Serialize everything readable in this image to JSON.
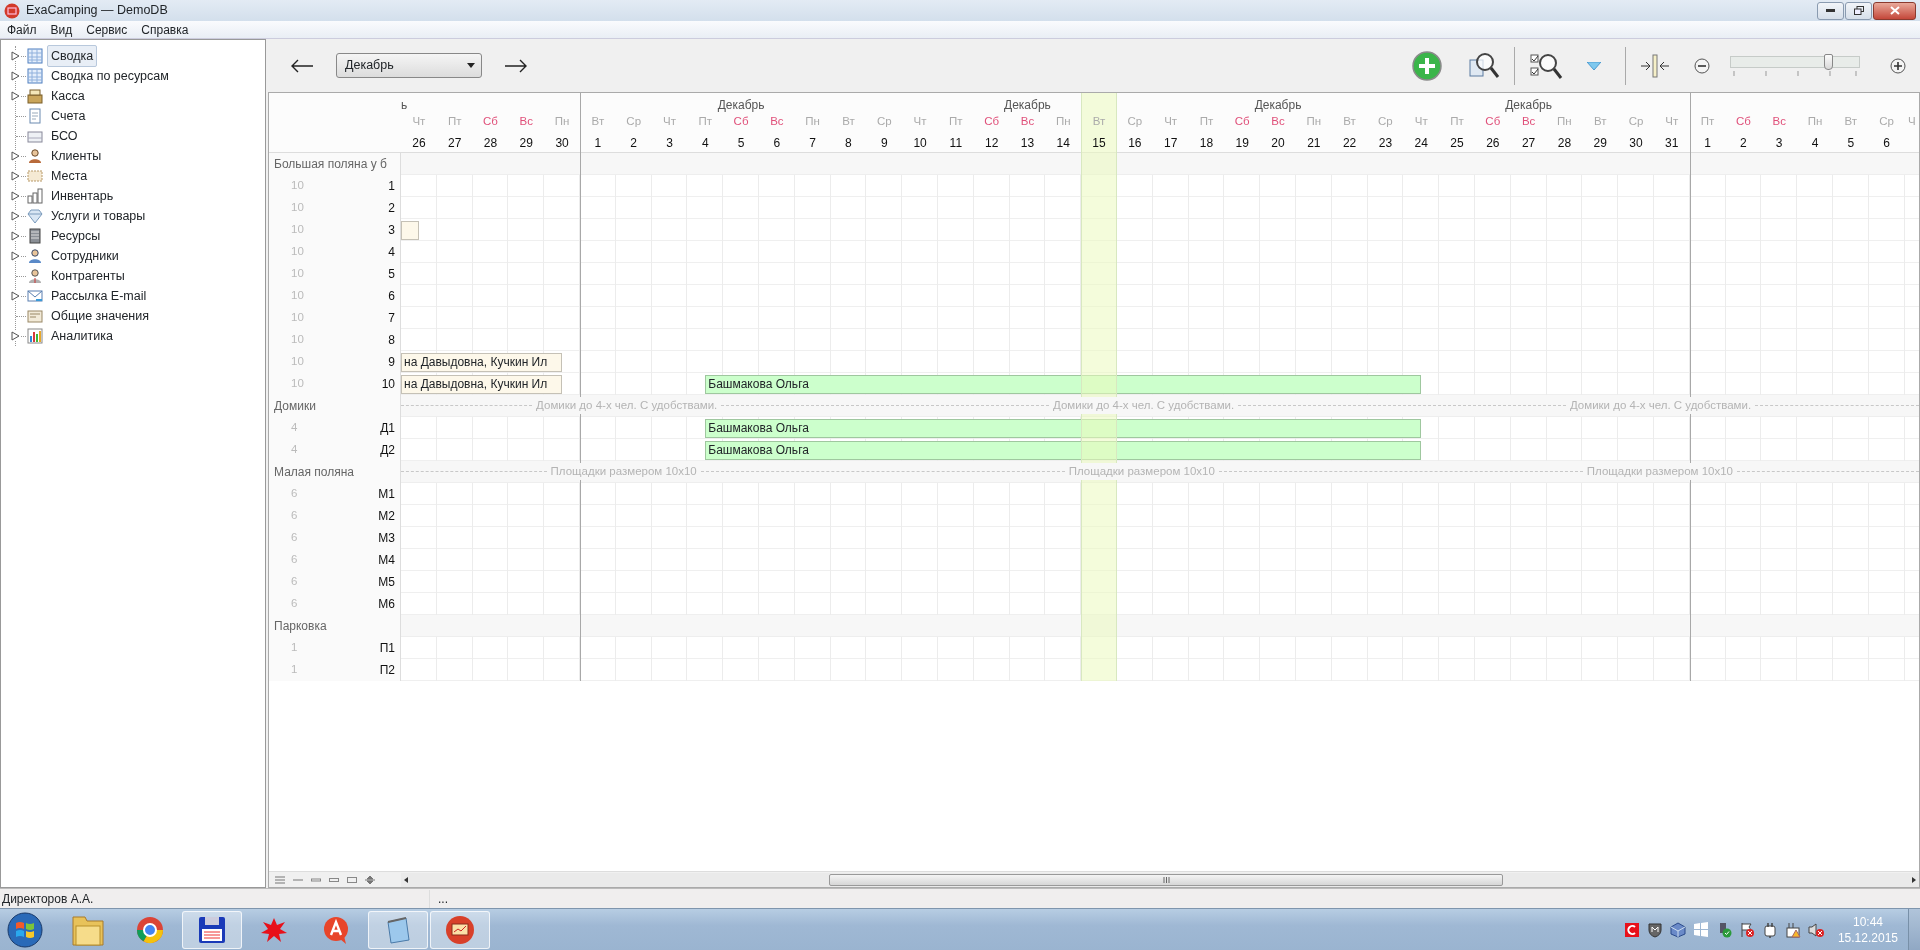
{
  "window": {
    "title": "ExaCamping — DemoDB"
  },
  "menu": [
    "Файл",
    "Вид",
    "Сервис",
    "Справка"
  ],
  "sidebar": {
    "items": [
      {
        "label": "Сводка",
        "expandable": true,
        "selected": true
      },
      {
        "label": "Сводка по ресурсам",
        "expandable": true,
        "selected": false
      },
      {
        "label": "Касса",
        "expandable": true,
        "selected": false
      },
      {
        "label": "Счета",
        "expandable": false,
        "selected": false
      },
      {
        "label": "БСО",
        "expandable": false,
        "selected": false
      },
      {
        "label": "Клиенты",
        "expandable": true,
        "selected": false
      },
      {
        "label": "Места",
        "expandable": true,
        "selected": false
      },
      {
        "label": "Инвентарь",
        "expandable": true,
        "selected": false
      },
      {
        "label": "Услуги и товары",
        "expandable": true,
        "selected": false
      },
      {
        "label": "Ресурсы",
        "expandable": true,
        "selected": false
      },
      {
        "label": "Сотрудники",
        "expandable": true,
        "selected": false
      },
      {
        "label": "Контрагенты",
        "expandable": false,
        "selected": false
      },
      {
        "label": "Рассылка E-mail",
        "expandable": true,
        "selected": false
      },
      {
        "label": "Общие значения",
        "expandable": false,
        "selected": false
      },
      {
        "label": "Аналитика",
        "expandable": true,
        "selected": false
      }
    ]
  },
  "toolbar": {
    "month": "Декабрь",
    "zoom": {
      "level": 0.76
    }
  },
  "calendar": {
    "days": [
      {
        "month_label": "ь",
        "dow": "Чт",
        "date": "26",
        "weekend": false,
        "month_start": false,
        "today": false
      },
      {
        "dow": "Пт",
        "date": "27",
        "weekend": false,
        "month_start": false,
        "today": false
      },
      {
        "dow": "Сб",
        "date": "28",
        "weekend": true,
        "month_start": false,
        "today": false
      },
      {
        "dow": "Вс",
        "date": "29",
        "weekend": true,
        "month_start": false,
        "today": false
      },
      {
        "dow": "Пн",
        "date": "30",
        "weekend": false,
        "month_start": false,
        "today": false
      },
      {
        "dow": "Вт",
        "date": "1",
        "weekend": false,
        "month_start": true,
        "today": false
      },
      {
        "dow": "Ср",
        "date": "2",
        "weekend": false,
        "month_start": false,
        "today": false
      },
      {
        "dow": "Чт",
        "date": "3",
        "weekend": false,
        "month_start": false,
        "today": false
      },
      {
        "dow": "Пт",
        "date": "4",
        "weekend": false,
        "month_start": false,
        "today": false
      },
      {
        "month_label": "Декабрь",
        "dow": "Сб",
        "date": "5",
        "weekend": true,
        "month_start": false,
        "today": false
      },
      {
        "dow": "Вс",
        "date": "6",
        "weekend": true,
        "month_start": false,
        "today": false
      },
      {
        "dow": "Пн",
        "date": "7",
        "weekend": false,
        "month_start": false,
        "today": false
      },
      {
        "dow": "Вт",
        "date": "8",
        "weekend": false,
        "month_start": false,
        "today": false
      },
      {
        "dow": "Ср",
        "date": "9",
        "weekend": false,
        "month_start": false,
        "today": false
      },
      {
        "dow": "Чт",
        "date": "10",
        "weekend": false,
        "month_start": false,
        "today": false
      },
      {
        "dow": "Пт",
        "date": "11",
        "weekend": false,
        "month_start": false,
        "today": false
      },
      {
        "dow": "Сб",
        "date": "12",
        "weekend": true,
        "month_start": false,
        "today": false
      },
      {
        "month_label": "Декабрь",
        "dow": "Вс",
        "date": "13",
        "weekend": true,
        "month_start": false,
        "today": false
      },
      {
        "dow": "Пн",
        "date": "14",
        "weekend": false,
        "month_start": false,
        "today": false
      },
      {
        "dow": "Вт",
        "date": "15",
        "weekend": false,
        "month_start": false,
        "today": true
      },
      {
        "dow": "Ср",
        "date": "16",
        "weekend": false,
        "month_start": false,
        "today": false
      },
      {
        "dow": "Чт",
        "date": "17",
        "weekend": false,
        "month_start": false,
        "today": false
      },
      {
        "dow": "Пт",
        "date": "18",
        "weekend": false,
        "month_start": false,
        "today": false
      },
      {
        "dow": "Сб",
        "date": "19",
        "weekend": true,
        "month_start": false,
        "today": false
      },
      {
        "month_label": "Декабрь",
        "dow": "Вс",
        "date": "20",
        "weekend": true,
        "month_start": false,
        "today": false
      },
      {
        "dow": "Пн",
        "date": "21",
        "weekend": false,
        "month_start": false,
        "today": false
      },
      {
        "dow": "Вт",
        "date": "22",
        "weekend": false,
        "month_start": false,
        "today": false
      },
      {
        "dow": "Ср",
        "date": "23",
        "weekend": false,
        "month_start": false,
        "today": false
      },
      {
        "dow": "Чт",
        "date": "24",
        "weekend": false,
        "month_start": false,
        "today": false
      },
      {
        "dow": "Пт",
        "date": "25",
        "weekend": false,
        "month_start": false,
        "today": false
      },
      {
        "dow": "Сб",
        "date": "26",
        "weekend": true,
        "month_start": false,
        "today": false
      },
      {
        "month_label": "Декабрь",
        "dow": "Вс",
        "date": "27",
        "weekend": true,
        "month_start": false,
        "today": false
      },
      {
        "dow": "Пн",
        "date": "28",
        "weekend": false,
        "month_start": false,
        "today": false
      },
      {
        "dow": "Вт",
        "date": "29",
        "weekend": false,
        "month_start": false,
        "today": false
      },
      {
        "dow": "Ср",
        "date": "30",
        "weekend": false,
        "month_start": false,
        "today": false
      },
      {
        "dow": "Чт",
        "date": "31",
        "weekend": false,
        "month_start": false,
        "today": false
      },
      {
        "dow": "Пт",
        "date": "1",
        "weekend": false,
        "month_start": true,
        "today": false
      },
      {
        "dow": "Сб",
        "date": "2",
        "weekend": true,
        "month_start": false,
        "today": false
      },
      {
        "dow": "Вс",
        "date": "3",
        "weekend": true,
        "month_start": false,
        "today": false
      },
      {
        "dow": "Пн",
        "date": "4",
        "weekend": false,
        "month_start": false,
        "today": false
      },
      {
        "dow": "Вт",
        "date": "5",
        "weekend": false,
        "month_start": false,
        "today": false
      },
      {
        "dow": "Ср",
        "date": "6",
        "weekend": false,
        "month_start": false,
        "today": false
      },
      {
        "dow": "Ч",
        "weekend": false,
        "month_start": false,
        "today": false
      }
    ],
    "groups": [
      {
        "label": "Большая поляна у б",
        "rows": [
          {
            "capacity": "10",
            "label": "1"
          },
          {
            "capacity": "10",
            "label": "2"
          },
          {
            "capacity": "10",
            "label": "3",
            "cells": [
              {
                "kind": "end",
                "booking": {
                  "color": "#fdf8ea"
                }
              }
            ]
          },
          {
            "capacity": "10",
            "label": "4"
          },
          {
            "capacity": "10",
            "label": "5"
          },
          {
            "capacity": "10",
            "label": "6"
          },
          {
            "capacity": "10",
            "label": "7"
          },
          {
            "capacity": "10",
            "label": "8"
          },
          {
            "capacity": "10",
            "label": "9",
            "cells": [
              {
                "kind": "middle",
                "booking": {
                  "text": "на Давыдовна, Кучкин Ил",
                  "color": "#fdf8ea"
                }
              },
              {
                "kind": "middle"
              },
              {
                "kind": "middle"
              },
              {
                "kind": "middle"
              },
              {
                "kind": "end"
              }
            ]
          },
          {
            "capacity": "10",
            "label": "10",
            "cells": [
              {
                "kind": "middle",
                "booking": {
                  "text": "на Давыдовна, Кучкин Ил",
                  "color": "#fdf8ea"
                }
              },
              {
                "kind": "middle"
              },
              {
                "kind": "middle"
              },
              {
                "kind": "middle"
              },
              {
                "kind": "end"
              },
              {
                "kind": "free"
              },
              {
                "kind": "free"
              },
              {
                "kind": "free"
              },
              {
                "kind": "start",
                "booking": {
                  "text": "Башмакова Ольга",
                  "color": "#ccffcc"
                }
              },
              {
                "kind": "middle"
              },
              {
                "kind": "middle"
              },
              {
                "kind": "middle"
              },
              {
                "kind": "middle"
              },
              {
                "kind": "middle"
              },
              {
                "kind": "middle"
              },
              {
                "kind": "middle"
              },
              {
                "kind": "middle"
              },
              {
                "kind": "middle"
              },
              {
                "kind": "middle"
              },
              {
                "kind": "middle"
              },
              {
                "kind": "middle"
              },
              {
                "kind": "middle"
              },
              {
                "kind": "middle"
              },
              {
                "kind": "middle"
              },
              {
                "kind": "middle"
              },
              {
                "kind": "middle"
              },
              {
                "kind": "middle"
              },
              {
                "kind": "middle"
              },
              {
                "kind": "end"
              }
            ]
          }
        ]
      },
      {
        "label": "Домики",
        "notes": [
          "Домики до 4-х чел. С удобствами.",
          "Домики до 4-х чел. С удобствами.",
          "Домики до 4-х чел. С удобствами."
        ],
        "rows": [
          {
            "capacity": "4",
            "label": "Д1",
            "cells": [
              {
                "kind": "free"
              },
              {
                "kind": "free"
              },
              {
                "kind": "free"
              },
              {
                "kind": "free"
              },
              {
                "kind": "free"
              },
              {
                "kind": "free"
              },
              {
                "kind": "free"
              },
              {
                "kind": "free"
              },
              {
                "kind": "start",
                "booking": {
                  "text": "Башмакова Ольга",
                  "color": "#ccffcc"
                }
              },
              {
                "kind": "middle"
              },
              {
                "kind": "middle"
              },
              {
                "kind": "middle"
              },
              {
                "kind": "middle"
              },
              {
                "kind": "middle"
              },
              {
                "kind": "middle"
              },
              {
                "kind": "middle"
              },
              {
                "kind": "middle"
              },
              {
                "kind": "middle"
              },
              {
                "kind": "middle"
              },
              {
                "kind": "middle"
              },
              {
                "kind": "middle"
              },
              {
                "kind": "middle"
              },
              {
                "kind": "middle"
              },
              {
                "kind": "middle"
              },
              {
                "kind": "middle"
              },
              {
                "kind": "middle"
              },
              {
                "kind": "middle"
              },
              {
                "kind": "middle"
              },
              {
                "kind": "end"
              }
            ]
          },
          {
            "capacity": "4",
            "label": "Д2",
            "cells": [
              {
                "kind": "free"
              },
              {
                "kind": "free"
              },
              {
                "kind": "free"
              },
              {
                "kind": "free"
              },
              {
                "kind": "free"
              },
              {
                "kind": "free"
              },
              {
                "kind": "free"
              },
              {
                "kind": "free"
              },
              {
                "kind": "start",
                "booking": {
                  "text": "Башмакова Ольга",
                  "color": "#ccffcc"
                }
              },
              {
                "kind": "middle"
              },
              {
                "kind": "middle"
              },
              {
                "kind": "middle"
              },
              {
                "kind": "middle"
              },
              {
                "kind": "middle"
              },
              {
                "kind": "middle"
              },
              {
                "kind": "middle"
              },
              {
                "kind": "middle"
              },
              {
                "kind": "middle"
              },
              {
                "kind": "middle"
              },
              {
                "kind": "middle"
              },
              {
                "kind": "middle"
              },
              {
                "kind": "middle"
              },
              {
                "kind": "middle"
              },
              {
                "kind": "middle"
              },
              {
                "kind": "middle"
              },
              {
                "kind": "middle"
              },
              {
                "kind": "middle"
              },
              {
                "kind": "middle"
              },
              {
                "kind": "end"
              }
            ]
          }
        ]
      },
      {
        "label": "Малая поляна",
        "notes": [
          "Площадки размером 10x10",
          "Площадки размером 10x10",
          "Площадки размером 10x10"
        ],
        "rows": [
          {
            "capacity": "6",
            "label": "М1"
          },
          {
            "capacity": "6",
            "label": "М2"
          },
          {
            "capacity": "6",
            "label": "М3"
          },
          {
            "capacity": "6",
            "label": "М4"
          },
          {
            "capacity": "6",
            "label": "М5"
          },
          {
            "capacity": "6",
            "label": "М6"
          }
        ]
      },
      {
        "label": "Парковка",
        "rows": [
          {
            "capacity": "1",
            "label": "П1"
          },
          {
            "capacity": "1",
            "label": "П2"
          }
        ]
      }
    ]
  },
  "status_bar": {
    "user": "Директоров А.А.",
    "info": "..."
  },
  "taskbar": {
    "apps": [
      {
        "active": false
      },
      {
        "active": false
      },
      {
        "active": true
      },
      {
        "active": false
      },
      {
        "active": false
      },
      {
        "active": true
      },
      {
        "active": true
      }
    ],
    "clock": {
      "time": "10:44",
      "date": "15.12.2015"
    }
  }
}
